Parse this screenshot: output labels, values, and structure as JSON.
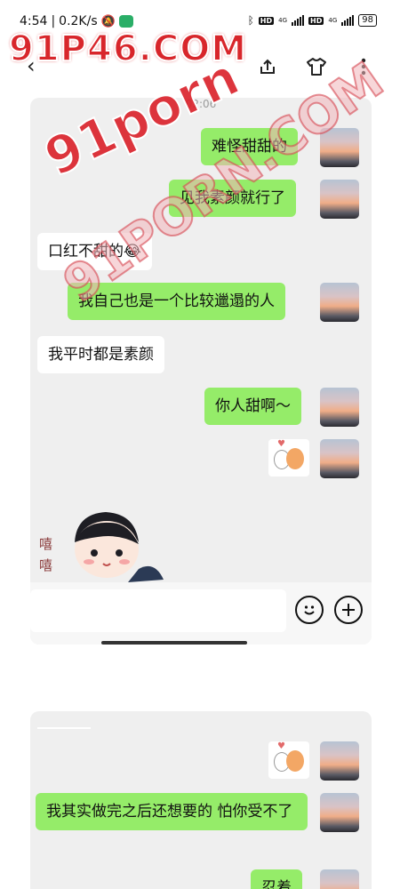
{
  "status": {
    "time": "4:54",
    "speed": "0.2K/s",
    "net1": "4G",
    "net2": "4G",
    "hd": "HD",
    "battery": "98"
  },
  "watermarks": {
    "top": "91P46.COM",
    "middle": "91porn",
    "diagonal": "91PORN.COM"
  },
  "chat1": {
    "timestamp": "02:06",
    "messages": [
      {
        "side": "me",
        "text": "难怪甜甜的"
      },
      {
        "side": "me",
        "text": "见我素颜就行了"
      },
      {
        "side": "other",
        "text": "口红不甜的😂"
      },
      {
        "side": "me",
        "text": "我自己也是一个比较邋遢的人"
      },
      {
        "side": "other",
        "text": "我平时都是素颜"
      },
      {
        "side": "me",
        "text": "你人甜啊～"
      }
    ],
    "sticker_text": "嘻嘻"
  },
  "chat2": {
    "messages": [
      {
        "side": "me",
        "text": "我其实做完之后还想要的 怕你受不了"
      },
      {
        "side": "me",
        "text": "忍着"
      }
    ]
  },
  "icons": {
    "back": "back-arrow-icon",
    "share": "share-icon",
    "shirt": "shirt-icon",
    "more": "more-vertical-icon",
    "emoji": "emoji-icon",
    "plus": "plus-icon"
  }
}
